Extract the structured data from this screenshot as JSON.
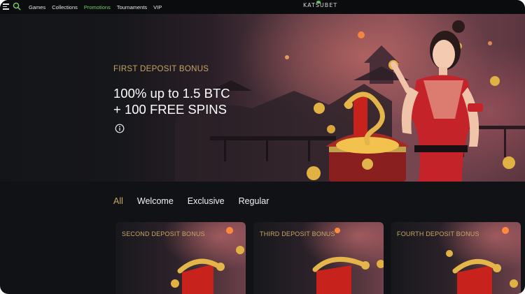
{
  "nav": {
    "items": [
      {
        "label": "Games",
        "active": false
      },
      {
        "label": "Collections",
        "active": false
      },
      {
        "label": "Promotions",
        "active": true
      },
      {
        "label": "Tournaments",
        "active": false
      },
      {
        "label": "VIP",
        "active": false
      }
    ],
    "logo": "KATSUBET",
    "icons": {
      "menu": "hamburger-icon",
      "search": "search-icon"
    }
  },
  "hero": {
    "label": "FIRST DEPOSIT BONUS",
    "title_line1": "100% up to 1.5 BTC",
    "title_line2": "+ 100 FREE SPINS",
    "info_icon": "info-icon"
  },
  "filters": {
    "tabs": [
      {
        "label": "All",
        "active": true
      },
      {
        "label": "Welcome",
        "active": false
      },
      {
        "label": "Exclusive",
        "active": false
      },
      {
        "label": "Regular",
        "active": false
      }
    ]
  },
  "cards": [
    {
      "title": "SECOND DEPOSIT BONUS"
    },
    {
      "title": "THIRD DEPOSIT BONUS"
    },
    {
      "title": "FOURTH DEPOSIT BONUS"
    }
  ],
  "colors": {
    "accent_gold": "#c9a866",
    "active_nav": "#6fd36a",
    "background": "#111215"
  }
}
